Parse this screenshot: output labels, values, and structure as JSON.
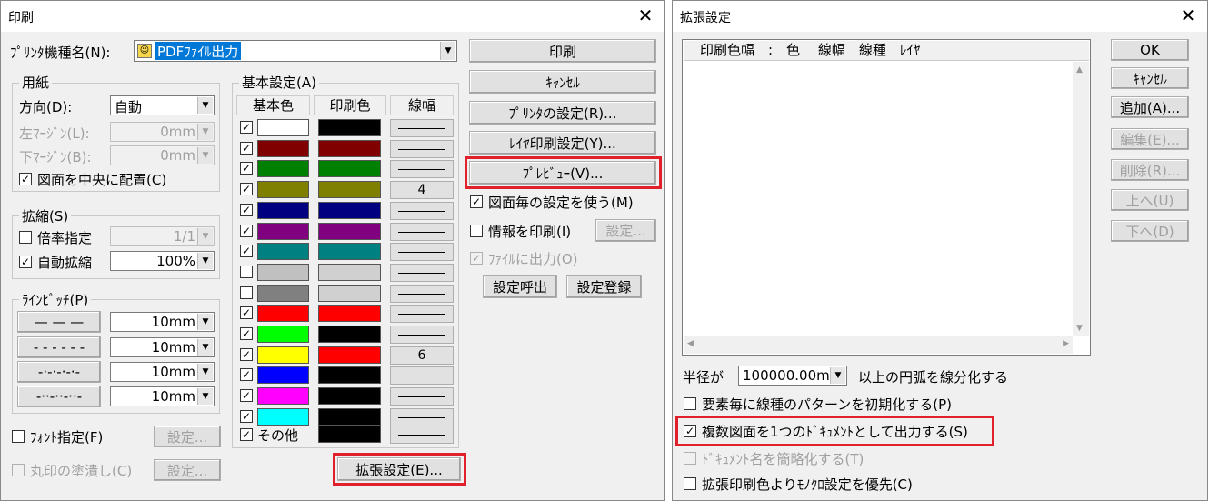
{
  "print_dialog": {
    "title": "印刷",
    "printer_label": "ﾌﾟﾘﾝﾀ機種名(N):",
    "printer_value": "PDFﾌｧｲﾙ出力",
    "paper": {
      "group": "用紙",
      "direction_label": "方向(D):",
      "direction_value": "自動",
      "left_margin_label": "左ﾏｰｼﾞﾝ(L):",
      "left_margin_value": "0mm",
      "bottom_margin_label": "下ﾏｰｼﾞﾝ(B):",
      "bottom_margin_value": "0mm",
      "center_label": "図面を中央に配置(C)"
    },
    "scale": {
      "group": "拡縮(S)",
      "ratio_label": "倍率指定",
      "ratio_value": "1/1",
      "auto_label": "自動拡縮",
      "auto_value": "100%"
    },
    "line_pitch": {
      "group": "ﾗｲﾝﾋﾟｯﾁ(P)",
      "rows": [
        {
          "pattern": "— — —",
          "value": "10mm"
        },
        {
          "pattern": "- - - - - -",
          "value": "10mm"
        },
        {
          "pattern": "-·-·-·-·-",
          "value": "10mm"
        },
        {
          "pattern": "-··-··-··-",
          "value": "10mm"
        }
      ]
    },
    "font_label": "ﾌｫﾝﾄ指定(F)",
    "font_setting": "設定...",
    "circle_label": "丸印の塗潰し(C)",
    "circle_setting": "設定...",
    "basic": {
      "group": "基本設定(A)",
      "headers": [
        "基本色",
        "印刷色",
        "線幅"
      ],
      "rows": [
        {
          "checked": true,
          "base": "#ffffff",
          "print": "#000000",
          "width": ""
        },
        {
          "checked": true,
          "base": "#800000",
          "print": "#800000",
          "width": ""
        },
        {
          "checked": true,
          "base": "#008000",
          "print": "#008000",
          "width": ""
        },
        {
          "checked": true,
          "base": "#808000",
          "print": "#808000",
          "width": "4"
        },
        {
          "checked": true,
          "base": "#000080",
          "print": "#000080",
          "width": ""
        },
        {
          "checked": true,
          "base": "#800080",
          "print": "#800080",
          "width": ""
        },
        {
          "checked": true,
          "base": "#008080",
          "print": "#008080",
          "width": ""
        },
        {
          "checked": false,
          "base": "#c0c0c0",
          "print": "#d0d0d0",
          "width": ""
        },
        {
          "checked": false,
          "base": "#808080",
          "print": "#d0d0d0",
          "width": ""
        },
        {
          "checked": true,
          "base": "#ff0000",
          "print": "#ff0000",
          "width": ""
        },
        {
          "checked": true,
          "base": "#00ff00",
          "print": "#000000",
          "width": ""
        },
        {
          "checked": true,
          "base": "#ffff00",
          "print": "#ff0000",
          "width": "6"
        },
        {
          "checked": true,
          "base": "#0000ff",
          "print": "#000000",
          "width": ""
        },
        {
          "checked": true,
          "base": "#ff00ff",
          "print": "#000000",
          "width": ""
        },
        {
          "checked": true,
          "base": "#00ffff",
          "print": "#000000",
          "width": ""
        }
      ],
      "other_label": "その他"
    },
    "buttons": {
      "print": "印刷",
      "cancel": "ｷｬﾝｾﾙ",
      "printer_setting": "ﾌﾟﾘﾝﾀの設定(R)...",
      "layer_setting": "ﾚｲﾔ印刷設定(Y)...",
      "preview": "ﾌﾟﾚﾋﾞｭｰ(V)...",
      "info_setting": "設定...",
      "load": "設定呼出",
      "register": "設定登録",
      "extended": "拡張設定(E)..."
    },
    "per_drawing_label": "図面毎の設定を使う(M)",
    "print_info_label": "情報を印刷(I)",
    "file_output_label": "ﾌｧｲﾙに出力(O)"
  },
  "ext_dialog": {
    "title": "拡張設定",
    "list_header": "印刷色幅　:　色　 線幅　線種　ﾚｲﾔ",
    "buttons": {
      "ok": "OK",
      "cancel": "ｷｬﾝｾﾙ",
      "add": "追加(A)...",
      "edit": "編集(E)...",
      "delete": "削除(R)...",
      "up": "上へ(U)",
      "down": "下へ(D)"
    },
    "radius_label": "半径が",
    "radius_value": "100000.00mm",
    "radius_suffix": "以上の円弧を線分化する",
    "opt1": "要素毎に線種のパターンを初期化する(P)",
    "opt2": "複数図面を1つのﾄﾞｷｭﾒﾝﾄとして出力する(S)",
    "opt3": "ﾄﾞｷｭﾒﾝﾄ名を簡略化する(T)",
    "opt4": "拡張印刷色よりﾓﾉｸﾛ設定を優先(C)"
  }
}
